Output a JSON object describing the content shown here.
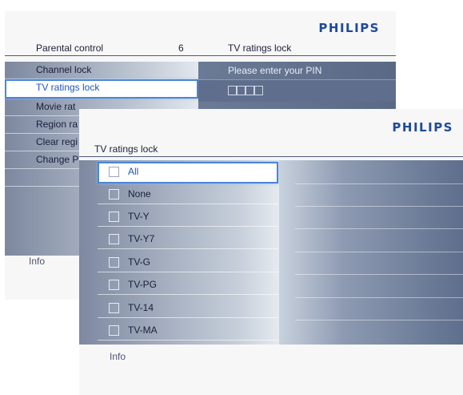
{
  "brand": "PHILIPS",
  "back_screen": {
    "header": {
      "title": "Parental control",
      "count": "6",
      "right_title": "TV ratings lock"
    },
    "menu_items": [
      {
        "label": "Channel lock",
        "selected": false
      },
      {
        "label": "TV ratings lock",
        "selected": true
      },
      {
        "label": "Movie rat",
        "selected": false
      },
      {
        "label": "Region ra",
        "selected": false
      },
      {
        "label": "Clear regi",
        "selected": false
      },
      {
        "label": "Change P",
        "selected": false
      },
      {
        "label": "",
        "selected": false
      }
    ],
    "pin_prompt": "Please enter your PIN",
    "pin_digits": 4,
    "info": "Info"
  },
  "front_screen": {
    "header": {
      "title": "TV ratings lock"
    },
    "options": [
      {
        "label": "All",
        "selected": true,
        "checked": false
      },
      {
        "label": "None",
        "selected": false,
        "checked": false
      },
      {
        "label": "TV-Y",
        "selected": false,
        "checked": false
      },
      {
        "label": "TV-Y7",
        "selected": false,
        "checked": false
      },
      {
        "label": "TV-G",
        "selected": false,
        "checked": false
      },
      {
        "label": "TV-PG",
        "selected": false,
        "checked": false
      },
      {
        "label": "TV-14",
        "selected": false,
        "checked": false
      },
      {
        "label": "TV-MA",
        "selected": false,
        "checked": false
      }
    ],
    "info": "Info"
  },
  "colors": {
    "accent": "#4b86d6",
    "brand": "#1f4a9c",
    "selected_text": "#1d55c4"
  }
}
